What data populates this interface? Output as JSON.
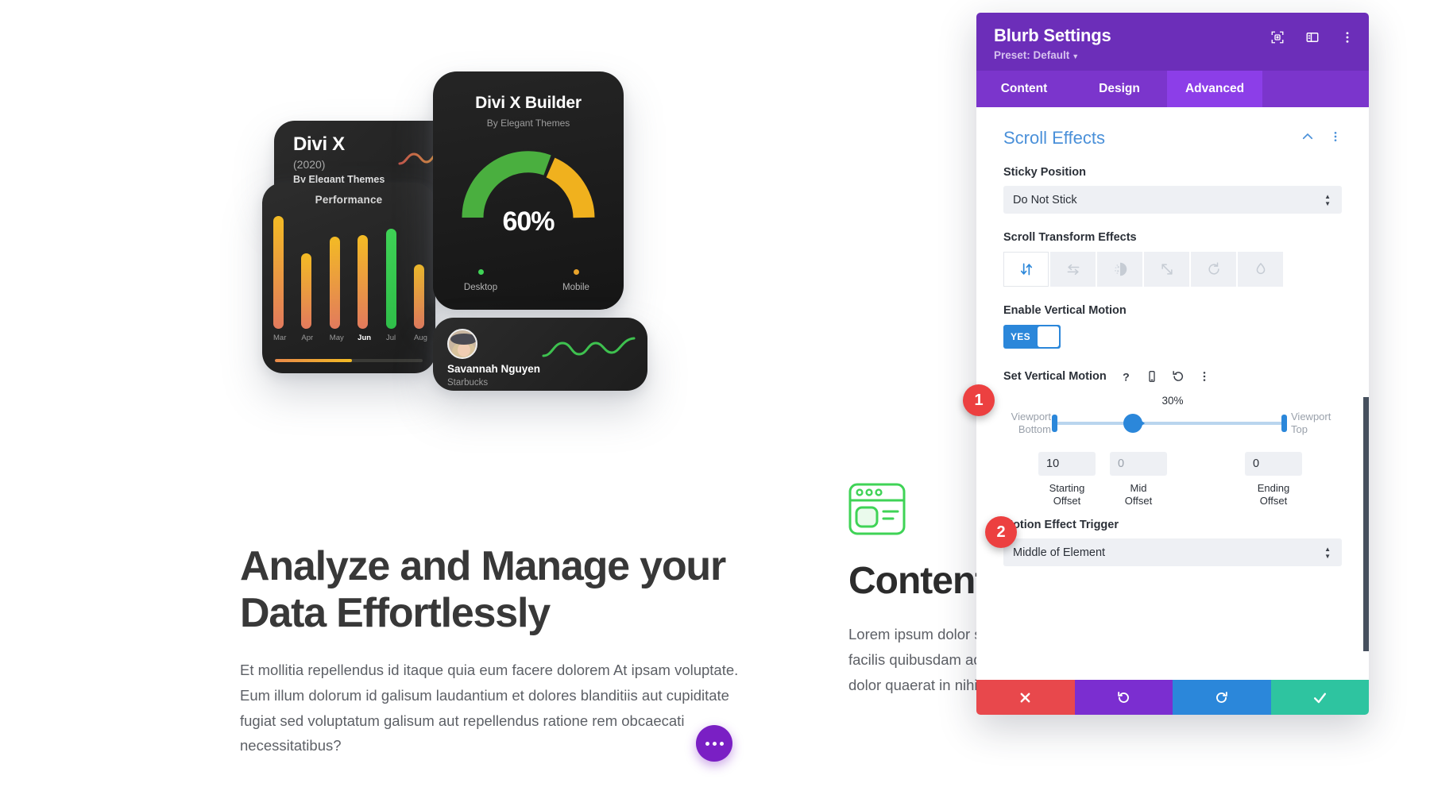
{
  "page": {
    "headline": "Analyze and Manage your Data Effortlessly",
    "body": "Et mollitia repellendus id itaque quia eum facere dolorem At ipsam voluptate. Eum illum dolorum id galisum laudantium et dolores blanditiis aut cupiditate fugiat sed voluptatum galisum aut repellendus ratione rem obcaecati necessitatibus?",
    "right_title": "Content",
    "right_body": "Lorem ipsum dolor sit amet aut assumenda quia voluptatem facilis quibusdam ad autem repellendus cum velit nobis vel dolor quaerat in nihil soluta."
  },
  "art": {
    "divix": {
      "title": "Divi X",
      "year": "(2020)",
      "author": "By Elegant Themes"
    },
    "builder": {
      "title": "Divi X Builder",
      "author": "By Elegant Themes",
      "percent": "60%",
      "legend": [
        {
          "label": "Desktop",
          "color": "#3fd356"
        },
        {
          "label": "Mobile",
          "color": "#e8a32b"
        }
      ]
    },
    "performance": {
      "title": "Performance",
      "months": [
        "Mar",
        "Apr",
        "May",
        "Jun",
        "Jul",
        "Aug"
      ],
      "heights": [
        100,
        67,
        82,
        83,
        89,
        57
      ],
      "highlight_index": 4,
      "bold_label_index": 3,
      "progress_percent": 52
    },
    "person": {
      "name": "Savannah Nguyen",
      "company": "Starbucks"
    }
  },
  "modal": {
    "title": "Blurb Settings",
    "preset": "Preset: Default",
    "head_icons": [
      "focus-icon",
      "layout-panel-icon",
      "more-vertical-icon"
    ],
    "tabs": [
      {
        "label": "Content",
        "active": false
      },
      {
        "label": "Design",
        "active": false
      },
      {
        "label": "Advanced",
        "active": true
      }
    ],
    "section": {
      "title": "Scroll Effects",
      "collapse_icon": "chevron-up-icon",
      "more_icon": "more-vertical-icon"
    },
    "sticky": {
      "label": "Sticky Position",
      "value": "Do Not Stick"
    },
    "transform": {
      "label": "Scroll Transform Effects",
      "effects": [
        {
          "name": "vertical-motion-icon",
          "active": true
        },
        {
          "name": "horizontal-motion-icon",
          "active": false
        },
        {
          "name": "fade-icon",
          "active": false
        },
        {
          "name": "scale-icon",
          "active": false
        },
        {
          "name": "rotate-icon",
          "active": false
        },
        {
          "name": "blur-icon",
          "active": false
        }
      ]
    },
    "vertical_motion": {
      "enable_label": "Enable Vertical Motion",
      "toggle_value": "YES",
      "set_label": "Set Vertical Motion",
      "tool_icons": [
        "help-icon",
        "mobile-icon",
        "reset-icon",
        "more-vertical-icon"
      ],
      "slider_percent": "30%",
      "slider_left_label": "Viewport Bottom",
      "slider_right_label": "Viewport Top",
      "handle_position_percent": 34,
      "offsets": [
        {
          "value": "10",
          "caption": "Starting Offset",
          "dim": false
        },
        {
          "value": "0",
          "caption": "Mid Offset",
          "dim": true
        },
        {
          "value": "0",
          "caption": "Ending Offset",
          "dim": false
        }
      ]
    },
    "trigger": {
      "label": "Motion Effect Trigger",
      "value": "Middle of Element"
    },
    "footer": [
      {
        "name": "cancel-button",
        "icon": "close-icon",
        "color": "#e8484c"
      },
      {
        "name": "undo-button",
        "icon": "undo-icon",
        "color": "#7b2ed0"
      },
      {
        "name": "redo-button",
        "icon": "redo-icon",
        "color": "#2b87da"
      },
      {
        "name": "save-button",
        "icon": "check-icon",
        "color": "#2ec4a0"
      }
    ]
  },
  "annotations": [
    {
      "number": "1",
      "target": "enable-vertical-motion-toggle"
    },
    {
      "number": "2",
      "target": "starting-offset-field"
    }
  ]
}
